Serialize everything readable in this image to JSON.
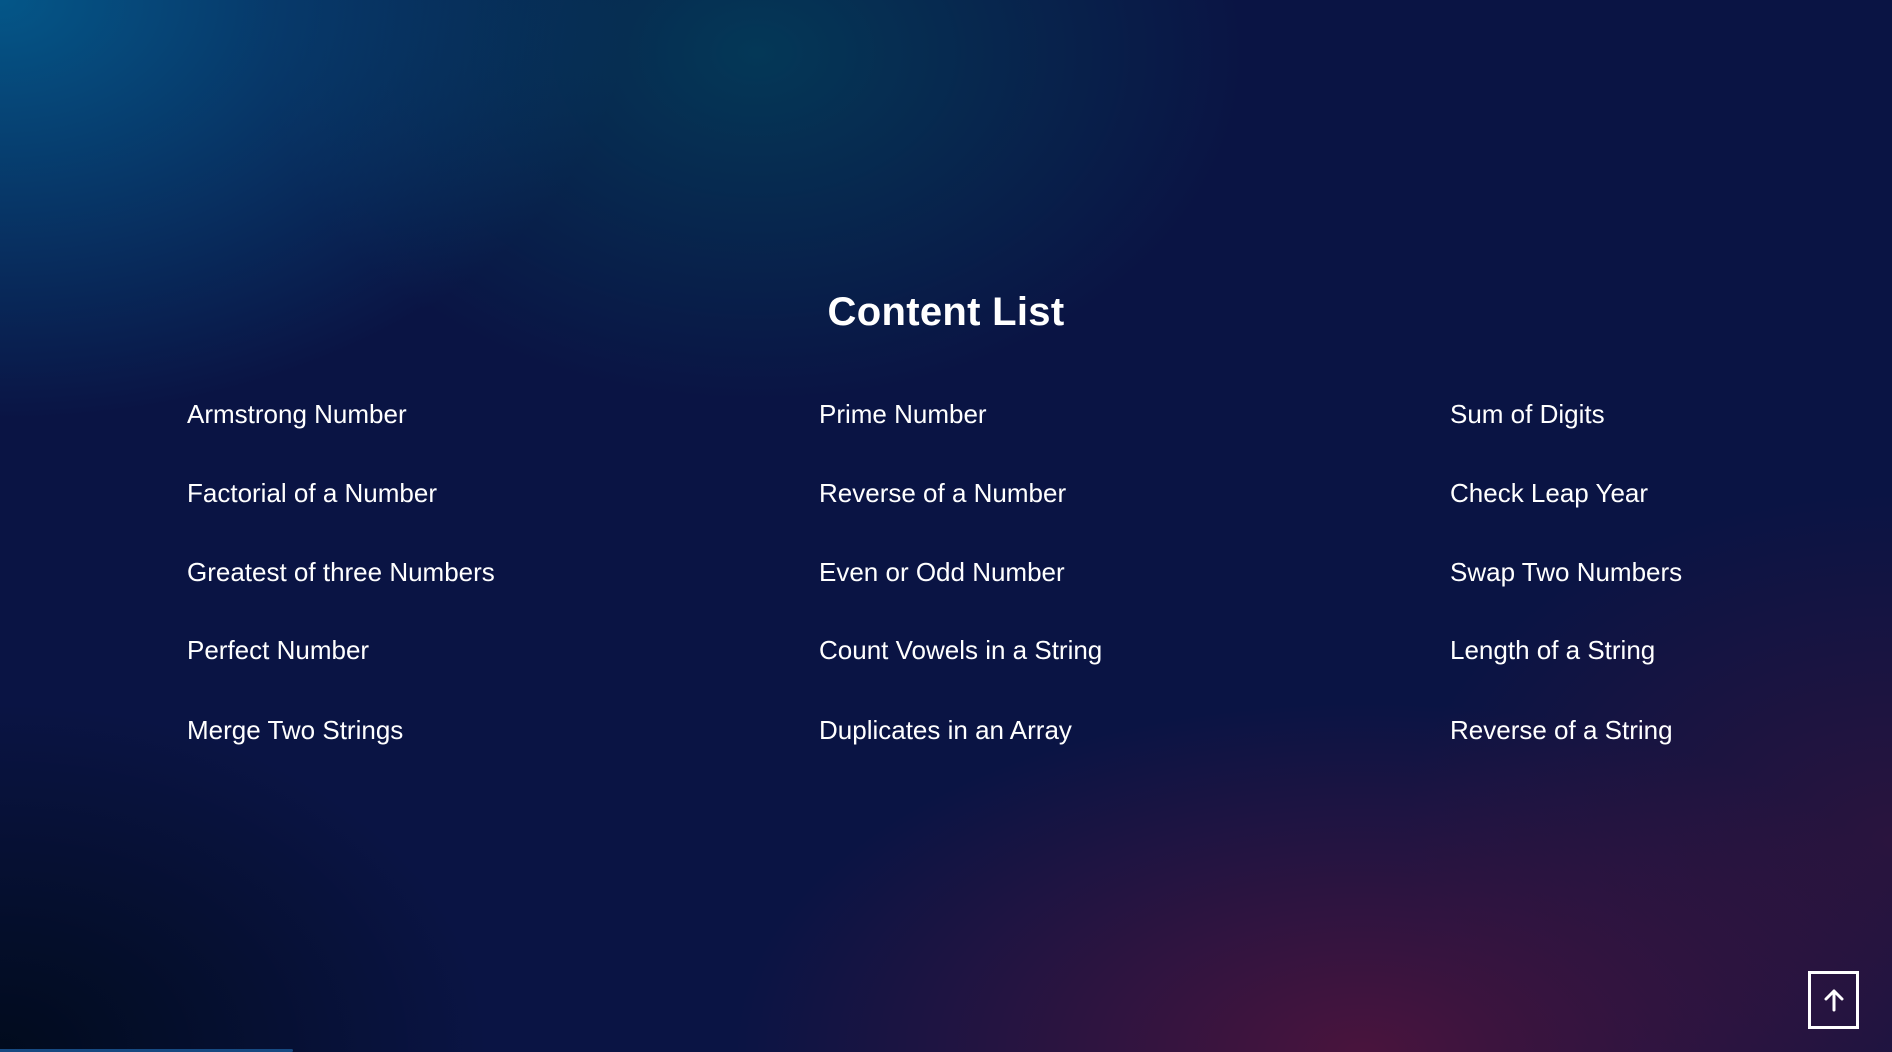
{
  "title": "Content List",
  "columns": [
    [
      "Armstrong Number",
      "Factorial of a Number",
      "Greatest of three Numbers",
      "Perfect Number",
      "Merge Two Strings"
    ],
    [
      "Prime Number",
      "Reverse of a Number",
      "Even or Odd Number",
      "Count Vowels in a String",
      "Duplicates in an Array"
    ],
    [
      "Sum of Digits",
      "Check Leap Year",
      "Swap Two Numbers",
      "Length of a String",
      "Reverse of a String"
    ]
  ],
  "scroll_to_top": {
    "icon": "arrow-up-icon"
  },
  "scroll_progress_percent": 15.5,
  "colors": {
    "progress": "#174a82",
    "text": "#ffffff"
  }
}
